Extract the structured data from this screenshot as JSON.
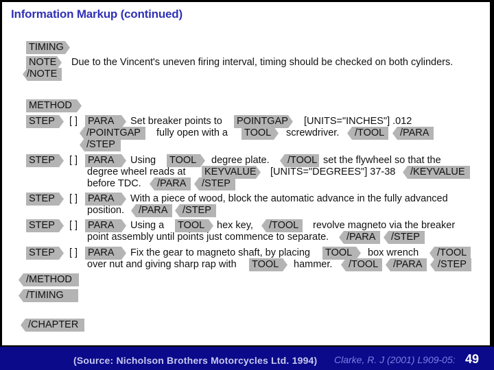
{
  "title": "Information Markup (continued)",
  "footer": {
    "source": "(Source: Nicholson Brothers Motorcycles Ltd. 1994)",
    "citation": "Clarke, R. J (2001) L909-05:",
    "page_number": "49"
  },
  "tags": {
    "timing": "TIMING",
    "timing_end": "/TIMING",
    "note": "NOTE",
    "note_end": "/NOTE",
    "method": "METHOD",
    "method_end": "/METHOD",
    "step": "STEP",
    "step_end": "/STEP",
    "para": "PARA",
    "para_end": "/PARA",
    "pointgap": "POINTGAP",
    "pointgap_end": "/POINTGAP",
    "tool": "TOOL",
    "tool_end": "/TOOL",
    "keyvalue": "KEYVALUE",
    "keyvalue_end": "/KEYVALUE",
    "chapter_end": "/CHAPTER",
    "checkbox": "[ ]"
  },
  "note_text": "Due to the Vincent's uneven firing interval, timing should be checked on both cylinders.",
  "steps": [
    {
      "t1": "Set breaker points to",
      "t2": "[UNITS=\"INCHES\"] .012",
      "t3": "fully open with a",
      "t4": "screwdriver."
    },
    {
      "t1": "Using",
      "t2": "degree plate.",
      "t3": "set the flywheel so that the",
      "t4": "degree wheel reads at",
      "t5": "[UNITS=\"DEGREES\"] 37-38",
      "t6": "before TDC."
    },
    {
      "t1": "With a piece of wood, block the automatic advance in the fully advanced",
      "t2": "position."
    },
    {
      "t1": "Using a",
      "t2": "hex key,",
      "t3": "revolve magneto via the breaker",
      "t4": "point assembly until points just commence to separate."
    },
    {
      "t1": "Fix the gear to magneto shaft, by placing",
      "t2": "box wrench",
      "t3": "over nut and giving sharp rap with",
      "t4": "hammer."
    }
  ]
}
